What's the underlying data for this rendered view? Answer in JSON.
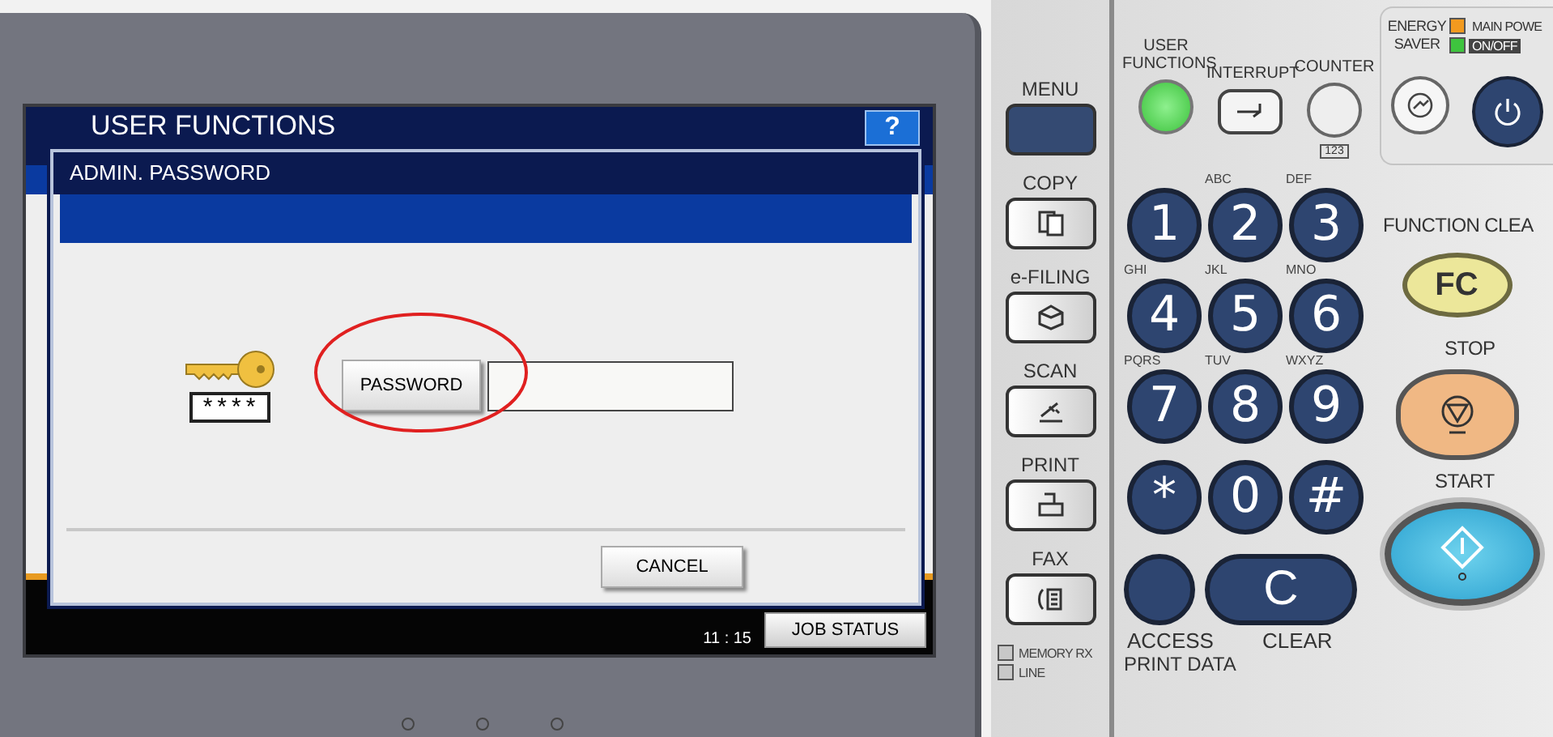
{
  "screen": {
    "title": "USER FUNCTIONS",
    "help_button": "?",
    "time": "11 : 15",
    "job_status_button": "JOB STATUS"
  },
  "dialog": {
    "title": "ADMIN. PASSWORD",
    "password_hint": "****",
    "password_button": "PASSWORD",
    "cancel_button": "CANCEL"
  },
  "mode_buttons": [
    {
      "label": "MENU",
      "kind": "menu"
    },
    {
      "label": "COPY",
      "kind": "copy"
    },
    {
      "label": "e-FILING",
      "kind": "filing"
    },
    {
      "label": "SCAN",
      "kind": "scan"
    },
    {
      "label": "PRINT",
      "kind": "print"
    },
    {
      "label": "FAX",
      "kind": "fax"
    }
  ],
  "line_lamps": [
    {
      "label": "MEMORY RX",
      "lit": false
    },
    {
      "label": "LINE",
      "lit": false
    }
  ],
  "top_keys": [
    {
      "label": "USER FUNCTIONS",
      "kind": "lamp",
      "lit": true
    },
    {
      "label": "INTERRUPT",
      "kind": "interrupt"
    },
    {
      "label": "COUNTER",
      "kind": "counter",
      "sub": "123"
    }
  ],
  "power": {
    "label": "ENERGY SAVER",
    "lamps": [
      {
        "label": "MAIN POWE",
        "color": "#f29a1f",
        "lit": true
      },
      {
        "label": "ON/OFF",
        "color": "#3ec43e",
        "lit": true
      }
    ]
  },
  "keypad": [
    {
      "keys": [
        {
          "key": "1"
        },
        {
          "key": "2",
          "letters": "ABC"
        },
        {
          "key": "3",
          "letters": "DEF"
        }
      ]
    },
    {
      "keys": [
        {
          "key": "4",
          "letters": "GHI"
        },
        {
          "key": "5",
          "letters": "JKL"
        },
        {
          "key": "6",
          "letters": "MNO"
        }
      ]
    },
    {
      "keys": [
        {
          "key": "7",
          "letters": "PQRS"
        },
        {
          "key": "8",
          "letters": "TUV"
        },
        {
          "key": "9",
          "letters": "WXYZ"
        }
      ]
    },
    {
      "keys": [
        {
          "key": "*"
        },
        {
          "key": "0"
        },
        {
          "key": "#"
        }
      ]
    }
  ],
  "function_clear": {
    "label": "FUNCTION CLEA",
    "key": "FC"
  },
  "stop": {
    "label": "STOP"
  },
  "start": {
    "label": "START"
  },
  "access": {
    "label": "ACCESS"
  },
  "clear": {
    "label": "CLEAR",
    "key": "C"
  },
  "print_data": "PRINT DATA"
}
